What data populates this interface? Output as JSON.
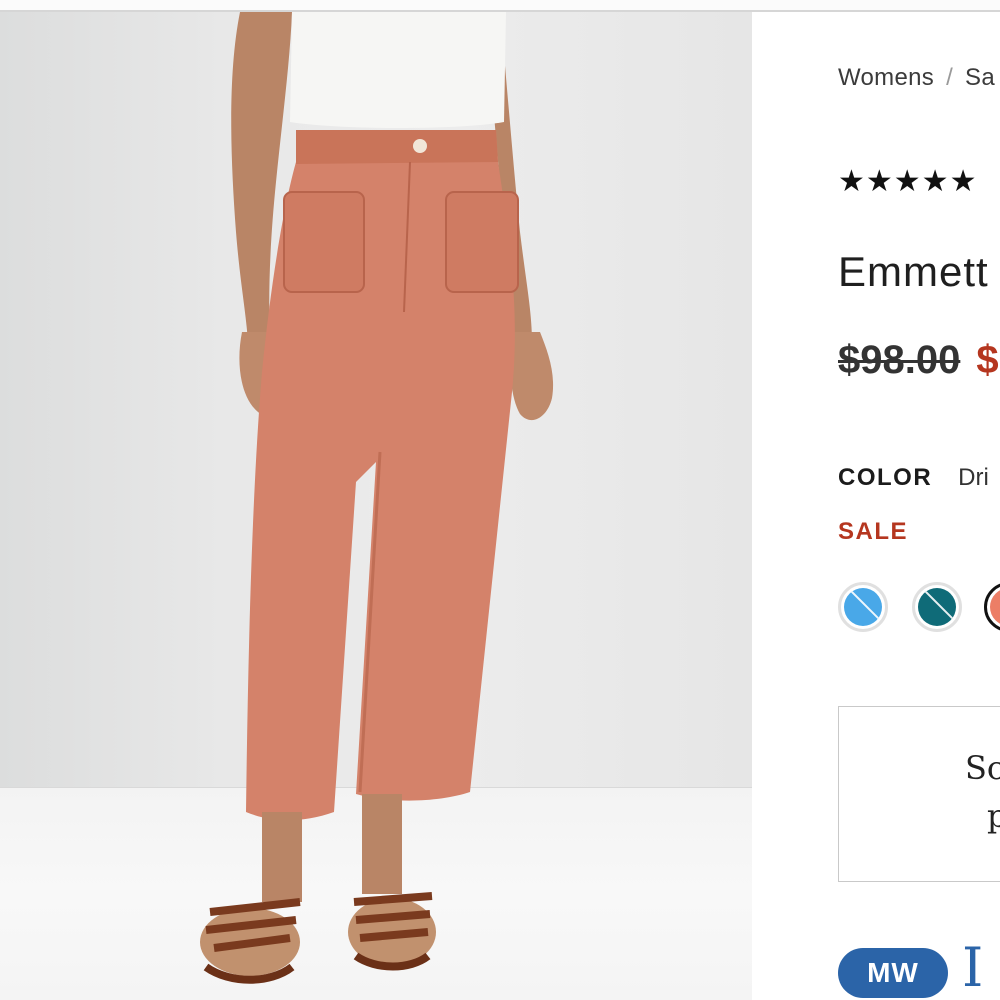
{
  "breadcrumb": {
    "items": [
      "Womens",
      "Sa"
    ]
  },
  "rating": {
    "stars": "★★★★★"
  },
  "product": {
    "title": "Emmett",
    "price_original": "$98.00",
    "price_sale": "$"
  },
  "color": {
    "label": "COLOR",
    "value": "Dri",
    "sale_label": "SALE"
  },
  "swatches": [
    {
      "name": "light-blue",
      "color": "#49a8e8"
    },
    {
      "name": "teal",
      "color": "#0f6b78"
    },
    {
      "name": "coral",
      "color": "#ec7e66"
    }
  ],
  "size_box": {
    "line1": "Sc",
    "line2": "p"
  },
  "badge": {
    "label": "MW"
  },
  "logo": {
    "letters": "I"
  },
  "colors": {
    "sale_red": "#b5361f",
    "brand_blue": "#2b64a8",
    "pant_color": "#d4826a"
  }
}
